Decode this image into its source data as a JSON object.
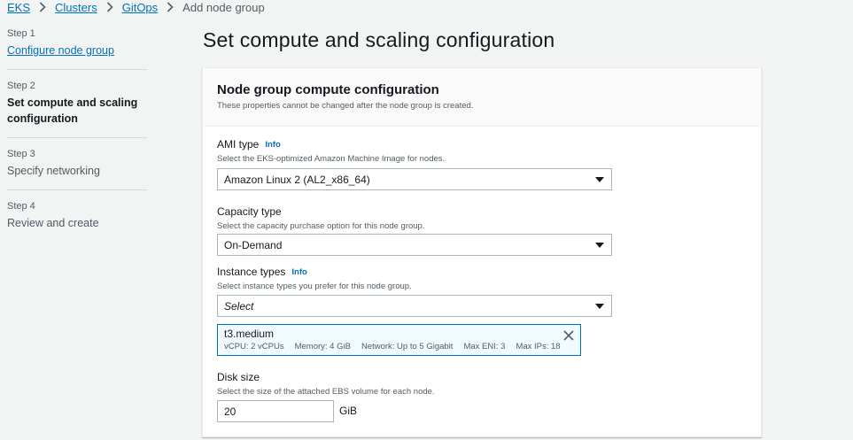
{
  "breadcrumb": {
    "items": [
      "EKS",
      "Clusters",
      "GitOps"
    ],
    "current": "Add node group"
  },
  "steps": [
    {
      "num": "Step 1",
      "title": "Configure node group",
      "state": "link"
    },
    {
      "num": "Step 2",
      "title": "Set compute and scaling configuration",
      "state": "current"
    },
    {
      "num": "Step 3",
      "title": "Specify networking",
      "state": "disabled"
    },
    {
      "num": "Step 4",
      "title": "Review and create",
      "state": "disabled"
    }
  ],
  "page_title": "Set compute and scaling configuration",
  "panel": {
    "title": "Node group compute configuration",
    "description": "These properties cannot be changed after the node group is created."
  },
  "ami": {
    "label": "AMI type",
    "info": "Info",
    "description": "Select the EKS-optimized Amazon Machine Image for nodes.",
    "value": "Amazon Linux 2 (AL2_x86_64)"
  },
  "capacity": {
    "label": "Capacity type",
    "description": "Select the capacity purchase option for this node group.",
    "value": "On-Demand"
  },
  "instance": {
    "label": "Instance types",
    "info": "Info",
    "description": "Select instance types you prefer for this node group.",
    "placeholder": "Select",
    "token": {
      "name": "t3.medium",
      "tags": [
        "vCPU: 2 vCPUs",
        "Memory: 4 GiB",
        "Network: Up to 5 Gigabit",
        "Max ENI: 3",
        "Max IPs: 18"
      ]
    }
  },
  "disk": {
    "label": "Disk size",
    "description": "Select the size of the attached EBS volume for each node.",
    "value": "20",
    "unit": "GiB"
  }
}
